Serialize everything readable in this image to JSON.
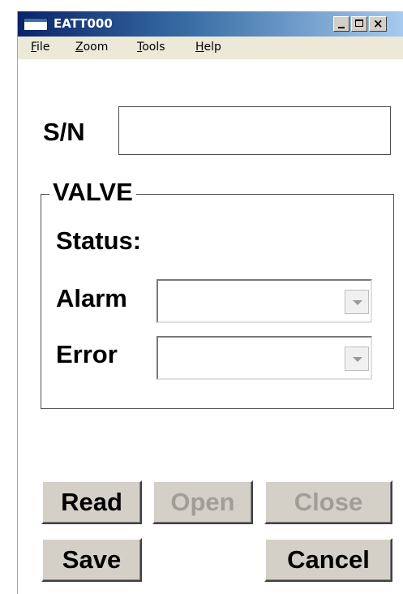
{
  "window": {
    "title": "EATT000",
    "close_glyph": "×"
  },
  "menu": {
    "items": [
      {
        "label": "File"
      },
      {
        "label": "Zoom"
      },
      {
        "label": "Tools"
      },
      {
        "label": "Help"
      }
    ]
  },
  "form": {
    "sn_label": "S/N",
    "sn_value": ""
  },
  "valve": {
    "group_title": "VALVE",
    "status_label": "Status:",
    "status_value": "",
    "alarm_label": "Alarm",
    "alarm_value": "",
    "error_label": "Error",
    "error_value": ""
  },
  "buttons": {
    "read": "Read",
    "open": "Open",
    "close": "Close",
    "save": "Save",
    "cancel": "Cancel"
  },
  "colors": {
    "titlebar_start": "#0a246a",
    "titlebar_end": "#a6caf0",
    "button_face": "#d4d0c8",
    "disabled_text": "#a09e98"
  },
  "icons": {
    "app": "app-window-icon",
    "minimize": "minimize-icon",
    "maximize": "maximize-icon",
    "close": "close-icon",
    "dropdown": "chevron-down-icon"
  }
}
